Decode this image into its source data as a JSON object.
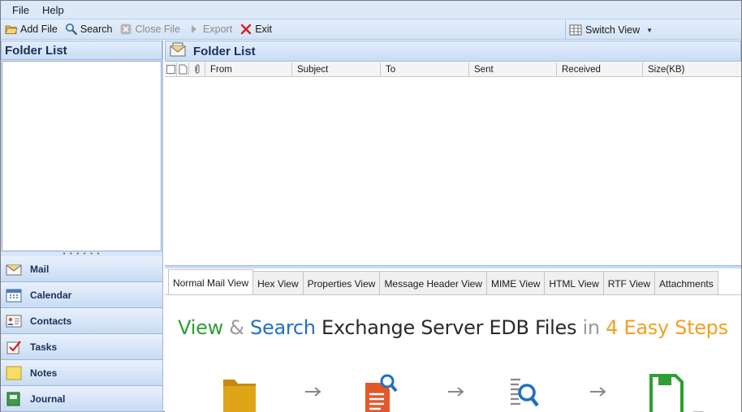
{
  "menu": {
    "file": "File",
    "help": "Help"
  },
  "toolbar": {
    "add_file": "Add File",
    "search": "Search",
    "close_file": "Close File",
    "export": "Export",
    "exit": "Exit",
    "switch_view": "Switch View"
  },
  "left_pane": {
    "header": "Folder List",
    "nav": [
      {
        "label": "Mail",
        "icon": "mail-icon"
      },
      {
        "label": "Calendar",
        "icon": "calendar-icon"
      },
      {
        "label": "Contacts",
        "icon": "contacts-icon"
      },
      {
        "label": "Tasks",
        "icon": "tasks-icon"
      },
      {
        "label": "Notes",
        "icon": "notes-icon"
      },
      {
        "label": "Journal",
        "icon": "journal-icon"
      }
    ]
  },
  "right_pane": {
    "header": "Folder List",
    "columns": [
      "From",
      "Subject",
      "To",
      "Sent",
      "Received",
      "Size(KB)"
    ]
  },
  "tabs": [
    "Normal Mail View",
    "Hex View",
    "Properties View",
    "Message Header View",
    "MIME View",
    "HTML View",
    "RTF View",
    "Attachments"
  ],
  "active_tab": "Normal Mail View",
  "promo": {
    "view": "View",
    "amp": "&",
    "search": "Search",
    "middle": "Exchange Server EDB Files",
    "in": "in",
    "steps": "4 Easy Steps"
  },
  "colors": {
    "accent_blue": "#1f6fc4",
    "accent_green": "#2f9e34",
    "accent_orange": "#f0a020",
    "pane_bg": "#d7e6f8"
  }
}
